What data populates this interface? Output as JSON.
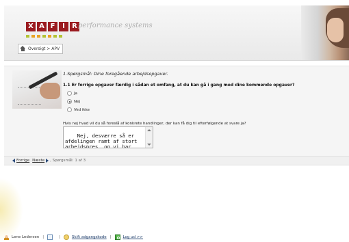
{
  "header": {
    "logo_letters": [
      "X",
      "A",
      "F",
      "I",
      "R"
    ],
    "tagline": "performance systems",
    "brand_color": "#9b1b20",
    "dots_colors": [
      "#b3c435",
      "#e9a324"
    ],
    "breadcrumb": {
      "home_icon": "home-icon",
      "text": "Oversigt > APV"
    }
  },
  "question": {
    "title": "1.Spørgsmål: Dine foregående arbejdsopgaver.",
    "text": "1.1 Er forrige opgaver færdig i sådan et omfang, at du kan gå i gang med dine kommende opgaver?",
    "options": [
      {
        "label": "Ja",
        "selected": false
      },
      {
        "label": "Nej",
        "selected": true
      },
      {
        "label": "Ved ikke",
        "selected": false
      }
    ],
    "followup_label": "Hvis nej hvad vil du så foreslå af konkrete handlinger, der kan få dig til efterfølgende at svare ja?",
    "followup_value": "Nej, desværre så er\nafdelingen ramt af stort\narbejdspres, og vi har"
  },
  "pager": {
    "prev_label": "Forrige",
    "next_label": "Næste",
    "status": ", Spørgsmål: 1 af 3"
  },
  "footer": {
    "user_name": "Lene Ledersen",
    "change_password": "Skift adgangskode",
    "logout": "Log ud >>"
  }
}
